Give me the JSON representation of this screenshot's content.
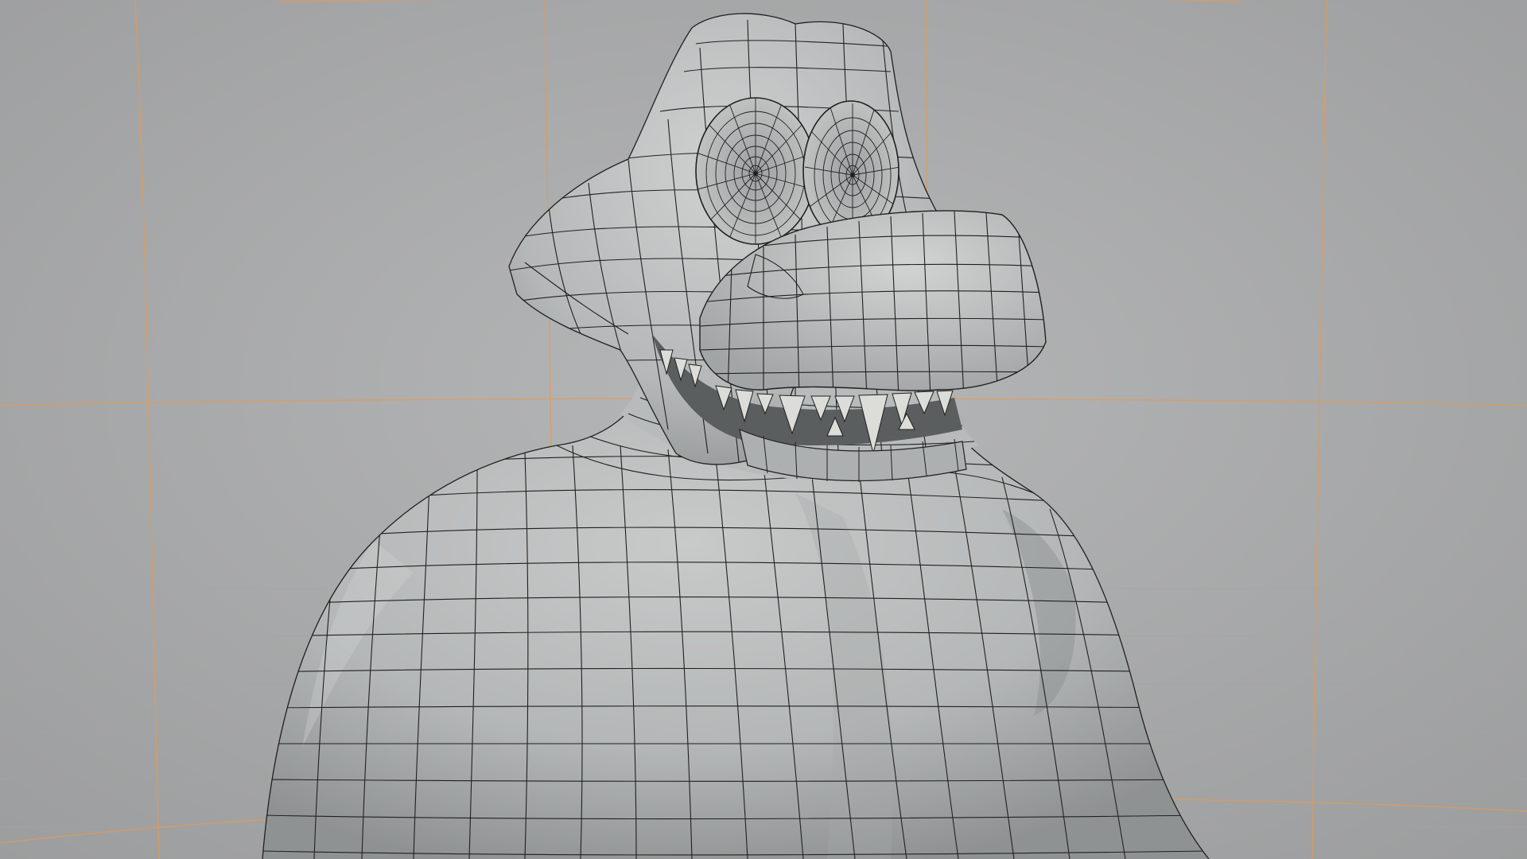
{
  "viewport": {
    "label": "",
    "shading": "solid",
    "overlay": "wireframe",
    "subject": "crocodile-character-mesh"
  },
  "colors": {
    "background": "#a9aaab",
    "background_light": "#b4b5b6",
    "guide_lines": "#e0904a",
    "mesh_fill": "#b9bcbc",
    "mesh_highlight": "#d4d6d6",
    "mesh_shadow": "#8e9191",
    "wire": "#1e2020",
    "mouth_dark": "#2a2c2c",
    "teeth": "#dcdcd8"
  }
}
